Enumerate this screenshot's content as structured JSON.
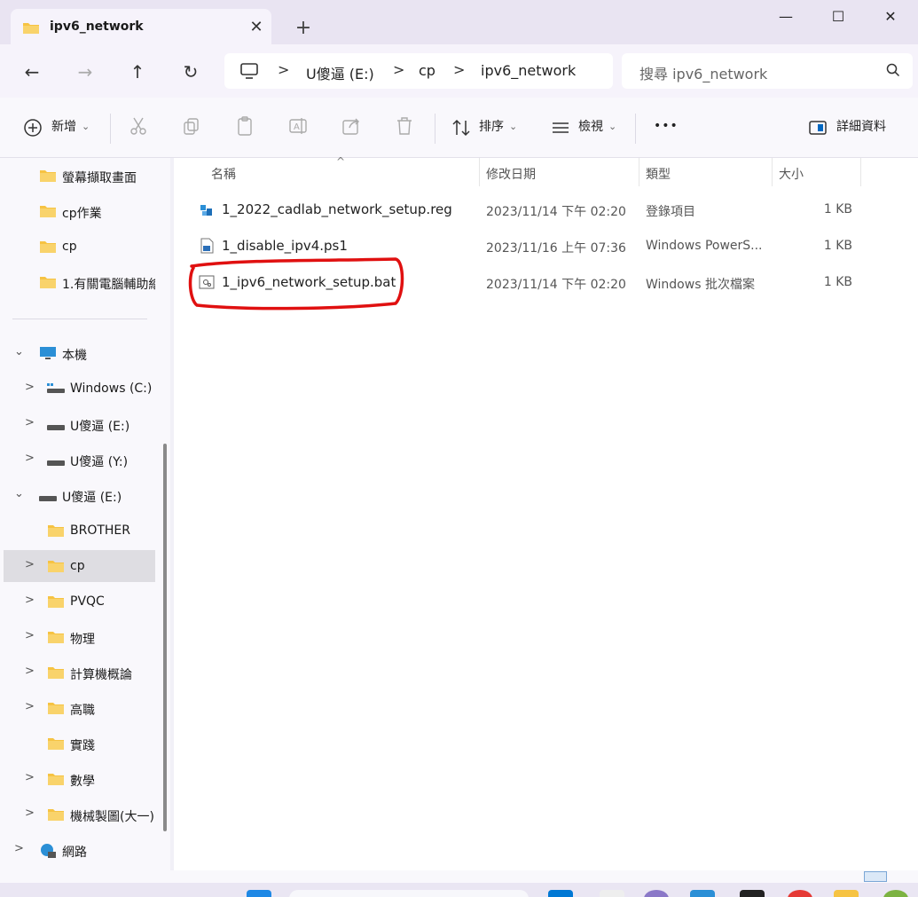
{
  "tab": {
    "title": "ipv6_network",
    "close": "✕",
    "new_tab": "+"
  },
  "window": {
    "minimize": "—",
    "maximize": "☐",
    "close": "✕"
  },
  "nav": {
    "back": "←",
    "forward": "→",
    "up": "↑",
    "refresh": "↻"
  },
  "address": {
    "crumbs": [
      "U傻逼 (E:)",
      "cp",
      "ipv6_network"
    ],
    "sep": ">"
  },
  "search": {
    "placeholder": "搜尋 ipv6_network"
  },
  "commands": {
    "new": "新增",
    "sort": "排序",
    "view": "檢視",
    "more": "•••",
    "details": "詳細資料",
    "dropdown": "⌄"
  },
  "sidebar": {
    "quick": [
      "螢幕擷取畫面",
      "cp作業",
      "cp",
      "1.有關電腦輔助繪"
    ],
    "this_pc": "本機",
    "drives": [
      "Windows (C:)",
      "U傻逼 (E:)",
      "U傻逼 (Y:)"
    ],
    "expanded_drive": "U傻逼 (E:)",
    "folders": [
      "BROTHER",
      "cp",
      "PVQC",
      "物理",
      "計算機概論",
      "高職",
      "實踐",
      "數學",
      "機械製圖(大一)"
    ],
    "network": "網路",
    "chev_right": ">",
    "chev_down": "⌄"
  },
  "columns": {
    "name": "名稱",
    "date": "修改日期",
    "type": "類型",
    "size": "大小",
    "sort_caret": "^"
  },
  "files": [
    {
      "name": "1_2022_cadlab_network_setup.reg",
      "date": "2023/11/14 下午 02:20",
      "type": "登錄項目",
      "size": "1 KB",
      "icon": "registry-icon"
    },
    {
      "name": "1_disable_ipv4.ps1",
      "date": "2023/11/16 上午 07:36",
      "type": "Windows PowerS...",
      "size": "1 KB",
      "icon": "powershell-icon"
    },
    {
      "name": "1_ipv6_network_setup.bat",
      "date": "2023/11/14 下午 02:20",
      "type": "Windows 批次檔案",
      "size": "1 KB",
      "icon": "batch-file-icon"
    }
  ],
  "colors": {
    "highlight_circle": "#e01010",
    "folder": "#f6c343",
    "accent": "#0067c0"
  }
}
